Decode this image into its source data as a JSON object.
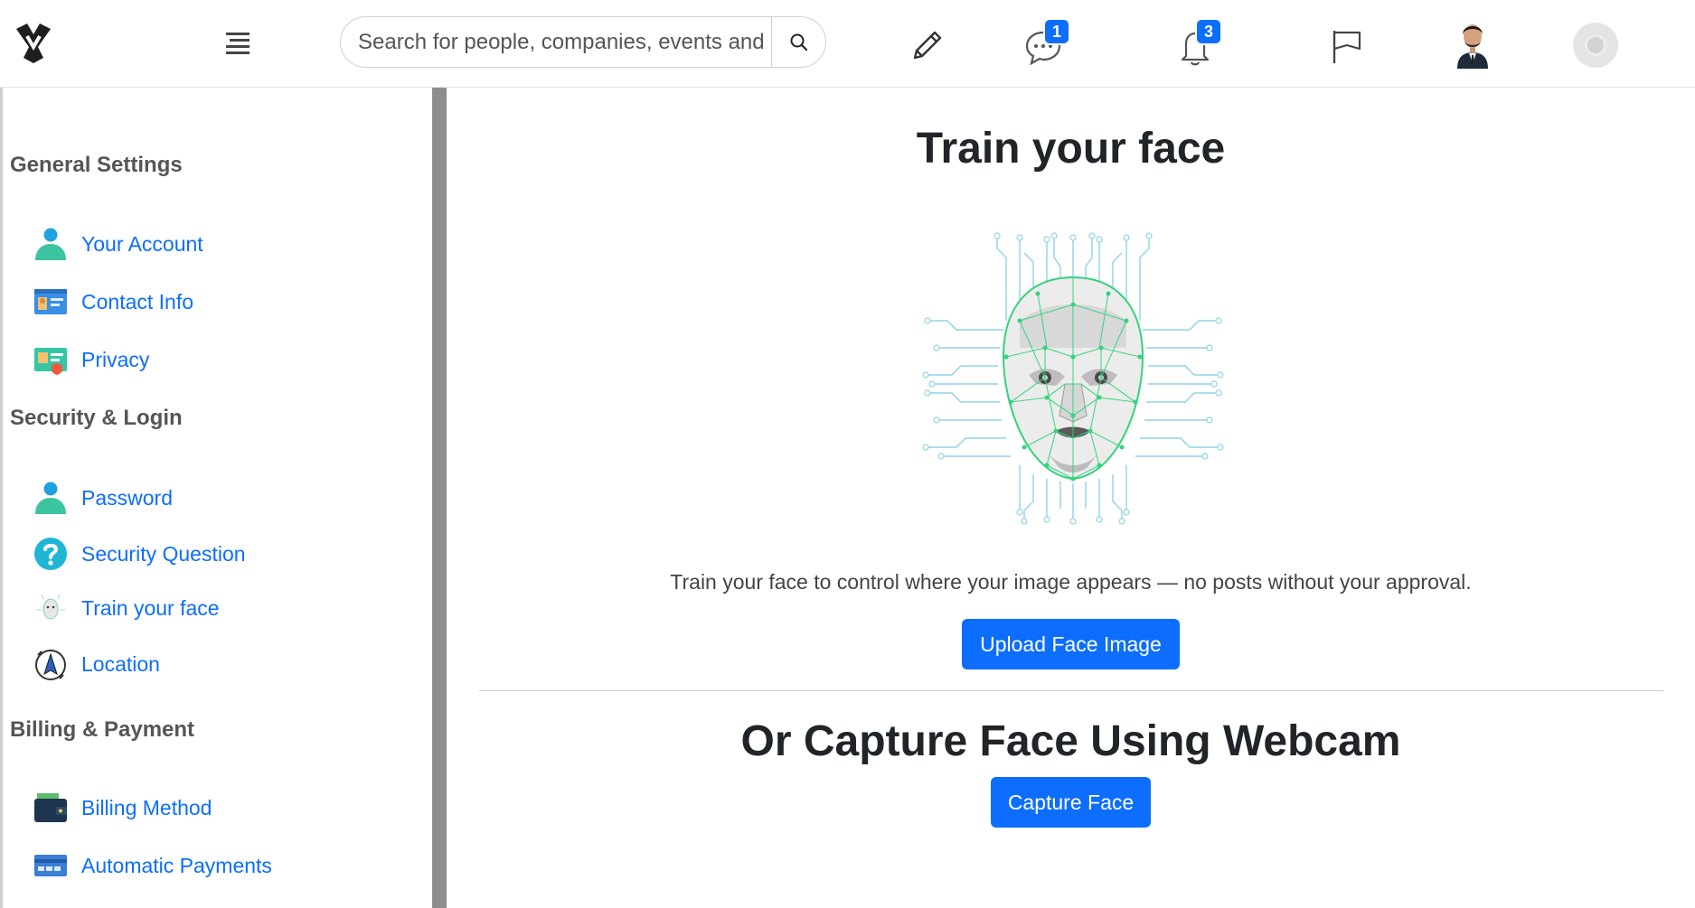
{
  "header": {
    "search_placeholder": "Search for people, companies, events and",
    "messages_badge": "1",
    "notifications_badge": "3"
  },
  "sidebar": {
    "sections": [
      {
        "title": "General Settings",
        "items": [
          {
            "label": "Your Account",
            "icon": "user-icon"
          },
          {
            "label": "Contact Info",
            "icon": "contact-card-icon"
          },
          {
            "label": "Privacy",
            "icon": "privacy-card-icon"
          }
        ]
      },
      {
        "title": "Security & Login",
        "items": [
          {
            "label": "Password",
            "icon": "user-icon"
          },
          {
            "label": "Security Question",
            "icon": "question-icon"
          },
          {
            "label": "Train your face",
            "icon": "face-icon"
          },
          {
            "label": "Location",
            "icon": "location-icon"
          }
        ]
      },
      {
        "title": "Billing & Payment",
        "items": [
          {
            "label": "Billing Method",
            "icon": "wallet-icon"
          },
          {
            "label": "Automatic Payments",
            "icon": "credit-card-icon"
          }
        ]
      }
    ]
  },
  "main": {
    "title": "Train your face",
    "description": "Train your face to control where your image appears — no posts without your approval.",
    "upload_button": "Upload Face Image",
    "webcam_title": "Or Capture Face Using Webcam",
    "capture_button": "Capture Face"
  },
  "colors": {
    "accent": "#0d6efd",
    "icon_teal": "#3cc3a0",
    "circuit_green": "#34d37c"
  }
}
